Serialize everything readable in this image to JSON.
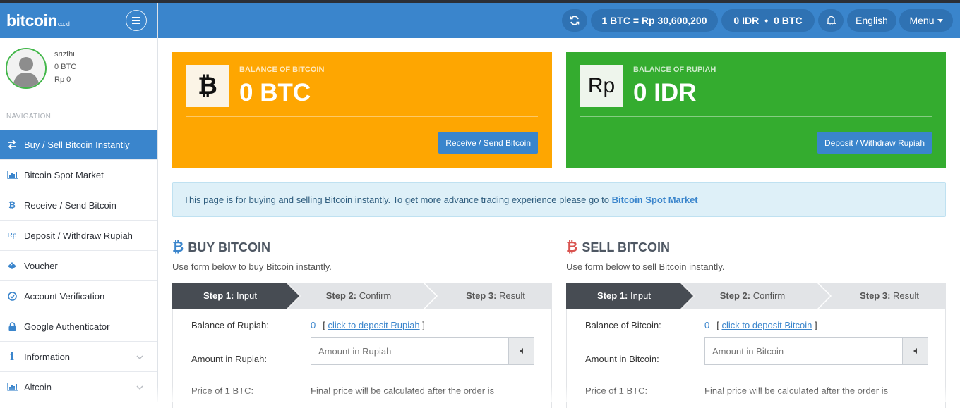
{
  "brand": {
    "name": "bitcoin",
    "suffix": "co.id"
  },
  "colors": {
    "primary": "#3a85cc",
    "btc_card": "#fea601",
    "idr_card": "#34ac2f",
    "sell_red": "#d9534f"
  },
  "profile": {
    "username": "srizthi",
    "btc": "0 BTC",
    "rp": "Rp 0"
  },
  "nav": {
    "label": "NAVIGATION",
    "items": [
      {
        "label": "Buy / Sell Bitcoin Instantly",
        "icon": "exchange-icon",
        "active": true
      },
      {
        "label": "Bitcoin Spot Market",
        "icon": "chart-icon"
      },
      {
        "label": "Receive / Send Bitcoin",
        "icon": "bitcoin-icon"
      },
      {
        "label": "Deposit / Withdraw Rupiah",
        "icon": "rupiah-icon"
      },
      {
        "label": "Voucher",
        "icon": "ticket-icon"
      },
      {
        "label": "Account Verification",
        "icon": "check-circle-icon"
      },
      {
        "label": "Google Authenticator",
        "icon": "lock-icon"
      },
      {
        "label": "Information",
        "icon": "info-icon",
        "expandable": true
      },
      {
        "label": "Altcoin",
        "icon": "chart-icon",
        "expandable": true
      }
    ]
  },
  "topbar": {
    "rate": "1 BTC = Rp 30,600,200",
    "wallet_idr": "0 IDR",
    "wallet_btc": "0 BTC",
    "language": "English",
    "menu": "Menu"
  },
  "cards": {
    "btc": {
      "icon_text": "₿",
      "label": "BALANCE OF BITCOIN",
      "value": "0 BTC",
      "button": "Receive / Send Bitcoin"
    },
    "idr": {
      "icon_text": "Rp",
      "label": "BALANCE OF RUPIAH",
      "value": "0 IDR",
      "button": "Deposit / Withdraw Rupiah"
    }
  },
  "notice": {
    "text": "This page is for buying and selling Bitcoin instantly. To get more advance trading experience please go to ",
    "link": "Bitcoin Spot Market"
  },
  "buy": {
    "title": "BUY BITCOIN",
    "subtitle": "Use form below to buy Bitcoin instantly.",
    "steps": [
      {
        "num": "Step 1:",
        "name": "Input"
      },
      {
        "num": "Step 2:",
        "name": "Confirm"
      },
      {
        "num": "Step 3:",
        "name": "Result"
      }
    ],
    "balance_label": "Balance of Rupiah:",
    "balance_value": "0",
    "balance_link": "click to deposit Rupiah",
    "amount_label": "Amount in Rupiah:",
    "amount_placeholder": "Amount in Rupiah",
    "price_label": "Price of 1 BTC:",
    "price_text": "Final price will be calculated after the order is"
  },
  "sell": {
    "title": "SELL BITCOIN",
    "subtitle": "Use form below to sell Bitcoin instantly.",
    "steps": [
      {
        "num": "Step 1:",
        "name": "Input"
      },
      {
        "num": "Step 2:",
        "name": "Confirm"
      },
      {
        "num": "Step 3:",
        "name": "Result"
      }
    ],
    "balance_label": "Balance of Bitcoin:",
    "balance_value": "0",
    "balance_link": "click to deposit Bitcoin",
    "amount_label": "Amount in Bitcoin:",
    "amount_placeholder": "Amount in Bitcoin",
    "price_label": "Price of 1 BTC:",
    "price_text": "Final price will be calculated after the order is"
  }
}
